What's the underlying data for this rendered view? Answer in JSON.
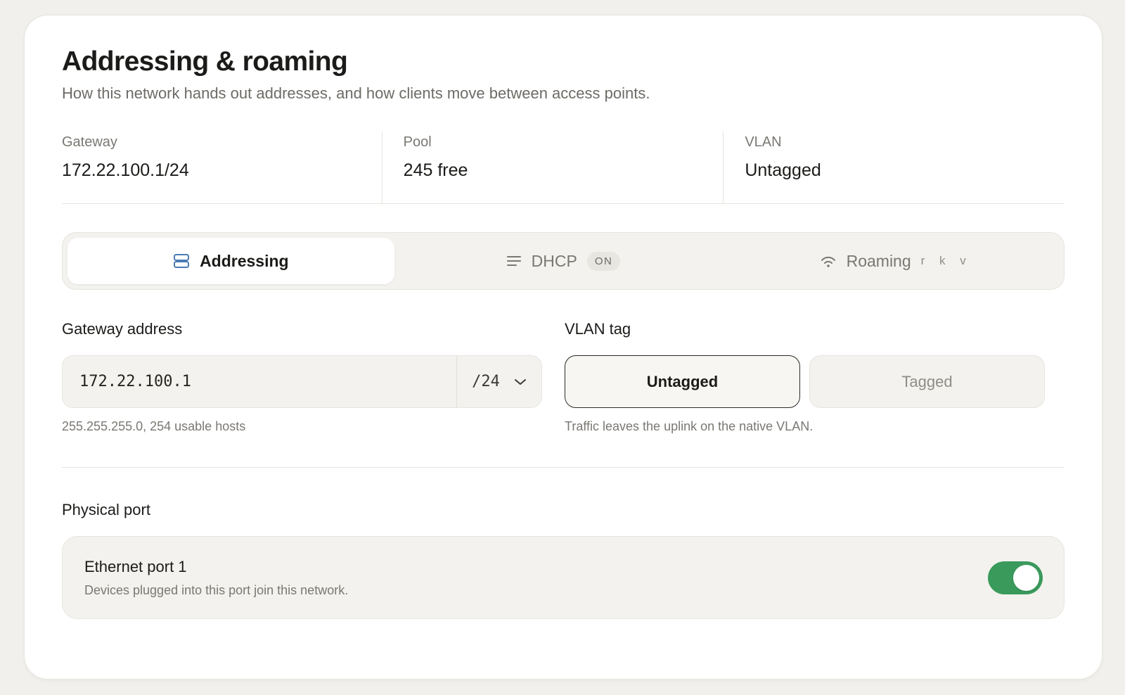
{
  "header": {
    "title": "Addressing & roaming",
    "subtitle": "How this network hands out addresses, and how clients move between access points."
  },
  "stats": [
    {
      "label": "Gateway",
      "value": "172.22.100.1/24"
    },
    {
      "label": "Pool",
      "value": "245 free"
    },
    {
      "label": "VLAN",
      "value": "Untagged"
    }
  ],
  "tabs": {
    "active": "Addressing",
    "items": [
      {
        "label": "Addressing",
        "icon": "server-stack-icon"
      },
      {
        "label": "DHCP",
        "icon": "lines-icon",
        "badge": "ON"
      },
      {
        "label": "Roaming",
        "icon": "wifi-signal-icon",
        "shortcut": "r k v"
      }
    ]
  },
  "gateway": {
    "label": "Gateway address",
    "value": "172.22.100.1",
    "prefix": "/24",
    "hint": "255.255.255.0, 254 usable hosts"
  },
  "vlan": {
    "label": "VLAN tag",
    "options": [
      "Untagged",
      "Tagged"
    ],
    "selected": "Untagged",
    "hint": "Traffic leaves the uplink on the native VLAN."
  },
  "port": {
    "section_label": "Physical port",
    "name": "Ethernet port 1",
    "description": "Devices plugged into this port join this network.",
    "enabled": true
  },
  "colors": {
    "background": "#f1f0ec",
    "toggle_on": "#3a9a5c",
    "icon_accent": "#4a7bb5"
  }
}
